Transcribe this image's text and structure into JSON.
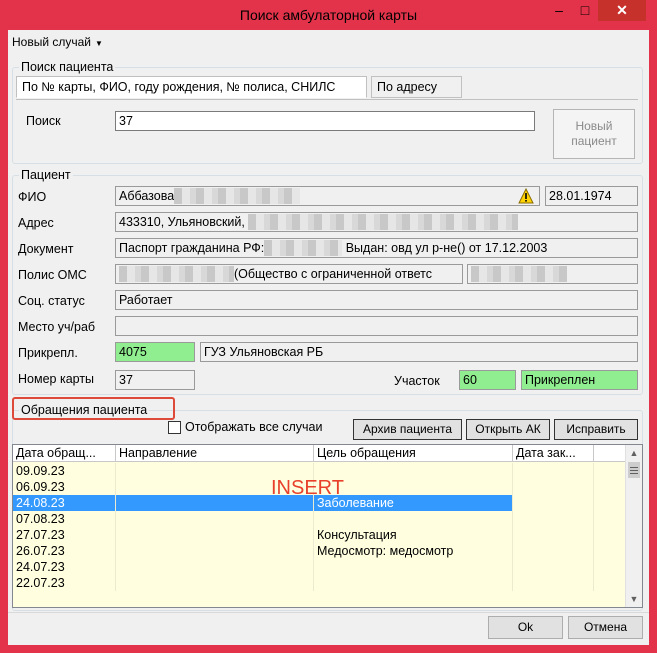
{
  "window": {
    "title": "Поиск амбулаторной карты",
    "min_glyph": "–",
    "max_glyph": "□",
    "close_glyph": "✕"
  },
  "menu": {
    "new_case": "Новый случай"
  },
  "search_group": {
    "legend": "Поиск пациента",
    "tabs": [
      "По № карты, ФИО, году рождения, № полиса, СНИЛС",
      "По адресу"
    ],
    "search_label": "Поиск",
    "search_value": "37",
    "new_patient_button": "Новый пациент"
  },
  "patient_group": {
    "legend": "Пациент",
    "fio_label": "ФИО",
    "fio_value": "Аббазова",
    "birth_date": "28.01.1974",
    "address_label": "Адрес",
    "address_value": "433310, Ульяновский, ",
    "document_label": "Документ",
    "document_prefix": "Паспорт гражданина РФ:",
    "document_suffix": " Выдан: овд ул р-не() от 17.12.2003",
    "policy_label": "Полис ОМС",
    "policy_value": "(Общество с ограниченной ответс",
    "social_label": "Соц. статус",
    "social_value": "Работает",
    "workplace_label": "Место уч/раб",
    "workplace_value": "",
    "attached_label": "Прикрепл.",
    "attached_code": "4075",
    "attached_org": "ГУЗ Ульяновская РБ",
    "card_label": "Номер карты",
    "card_value": "37",
    "district_label": "Участок",
    "district_value": "60",
    "attach_status": "Прикреплен"
  },
  "visits_group": {
    "legend": "Обращения пациента",
    "show_all_label": "Отображать все случаи",
    "show_all_checked": false,
    "archive_button": "Архив пациента",
    "open_ak_button": "Открыть АК",
    "fix_button": "Исправить",
    "columns": [
      "Дата обращ...",
      "Направление",
      "Цель обращения",
      "Дата зак..."
    ],
    "rows": [
      {
        "date": "09.09.23",
        "direction": "",
        "purpose": "",
        "close_date": ""
      },
      {
        "date": "06.09.23",
        "direction": "",
        "purpose": "",
        "close_date": ""
      },
      {
        "date": "24.08.23",
        "direction": "",
        "purpose": "Заболевание",
        "close_date": ""
      },
      {
        "date": "07.08.23",
        "direction": "",
        "purpose": "",
        "close_date": ""
      },
      {
        "date": "27.07.23",
        "direction": "",
        "purpose": "Консультация",
        "close_date": ""
      },
      {
        "date": "26.07.23",
        "direction": "",
        "purpose": "Медосмотр: медосмотр",
        "close_date": ""
      },
      {
        "date": "24.07.23",
        "direction": "",
        "purpose": "",
        "close_date": ""
      },
      {
        "date": "22.07.23",
        "direction": "",
        "purpose": "",
        "close_date": ""
      }
    ],
    "selected_row": 2,
    "insert_indicator": "INSERT"
  },
  "footer": {
    "ok_button": "Ok",
    "cancel_button": "Отмена"
  },
  "colors": {
    "titlebar": "#e3334a",
    "selection": "#3399ff",
    "attached_green": "#90ee90",
    "grid_bg": "#ffffe0",
    "insert_red": "#e8402a"
  }
}
